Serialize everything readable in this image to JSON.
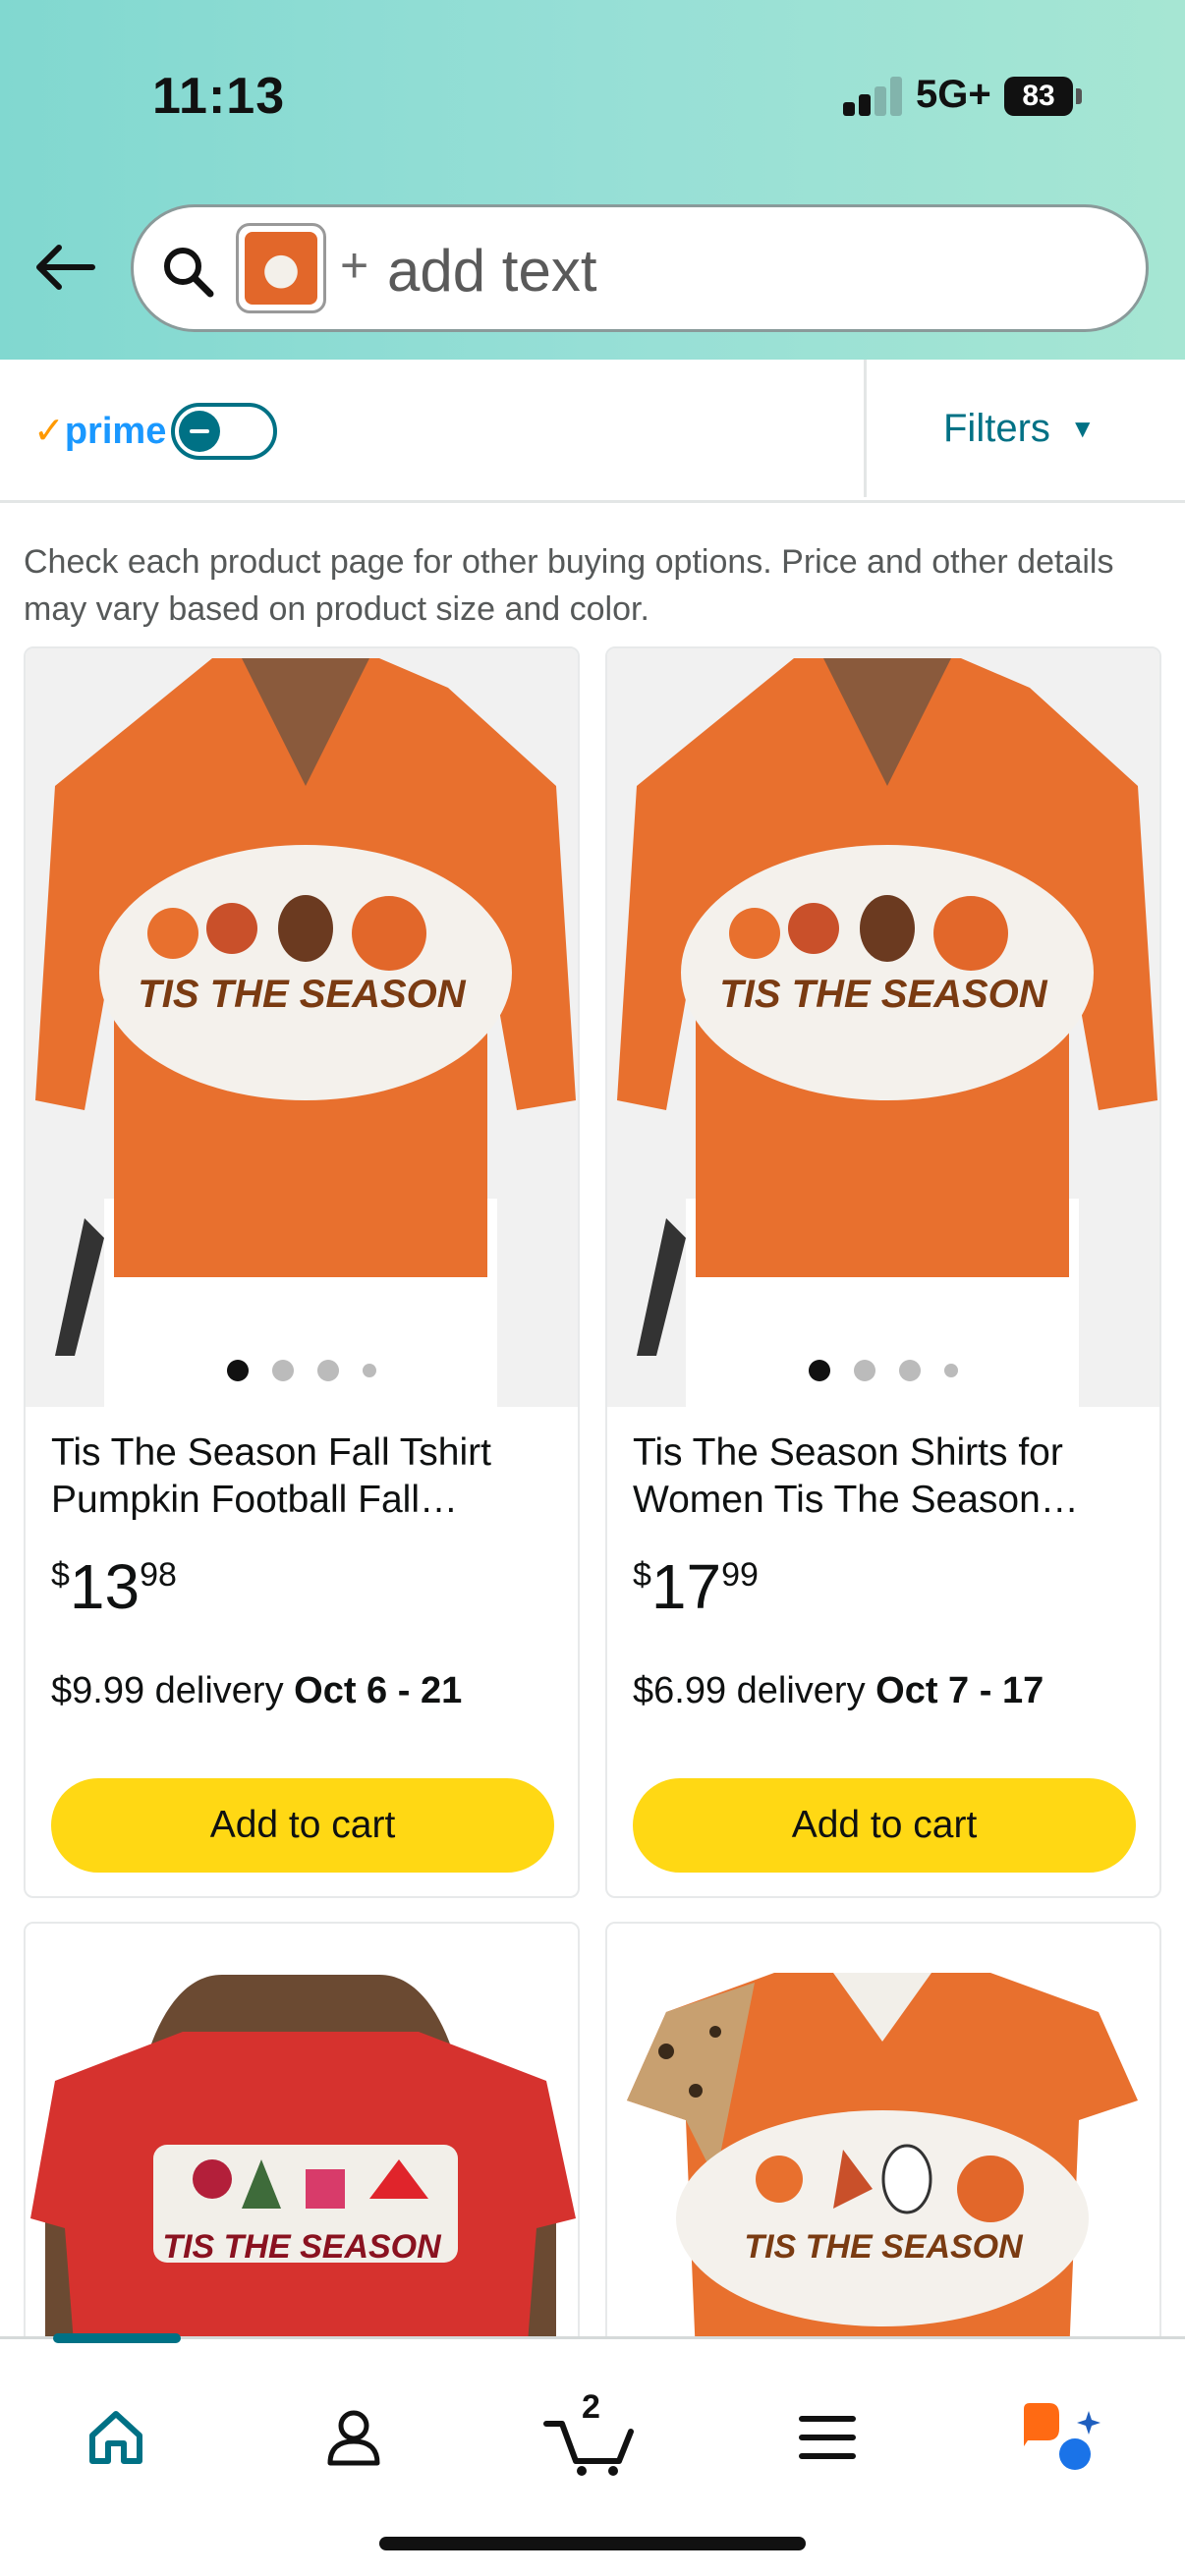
{
  "status_bar": {
    "time": "11:13",
    "network": "5G+",
    "battery": "83"
  },
  "search": {
    "plus": "+",
    "placeholder": "add text",
    "thumbnail_icon": "image-thumbnail"
  },
  "filter_bar": {
    "prime_check": "✓",
    "prime_label": "prime",
    "filters_label": "Filters"
  },
  "notice": "Check each product page for other buying options. Price and other details may vary based on product size and color.",
  "products": [
    {
      "title": "Tis The Season Fall Tshirt Pumpkin Football Fall…",
      "price_symbol": "$",
      "price_whole": "13",
      "price_fraction": "98",
      "delivery_fee": "$9.99 delivery",
      "delivery_dates": "Oct 6 - 21",
      "button": "Add to cart",
      "image_text": "TIS THE SEASON"
    },
    {
      "title": "Tis The Season Shirts for Women Tis The Season…",
      "price_symbol": "$",
      "price_whole": "17",
      "price_fraction": "99",
      "delivery_fee": "$6.99 delivery",
      "delivery_dates": "Oct 7 - 17",
      "button": "Add to cart",
      "image_text": "TIS THE SEASON"
    },
    {
      "image_text": "TIS THE SEASON"
    },
    {
      "image_text": "TIS THE SEASON"
    }
  ],
  "bottom_nav": {
    "cart_count": "2"
  },
  "colors": {
    "accent": "#007185",
    "button_yellow": "#ffd814",
    "prime_blue": "#1a98ff",
    "shirt_orange": "#e2672a",
    "shirt_red": "#d6322e"
  }
}
